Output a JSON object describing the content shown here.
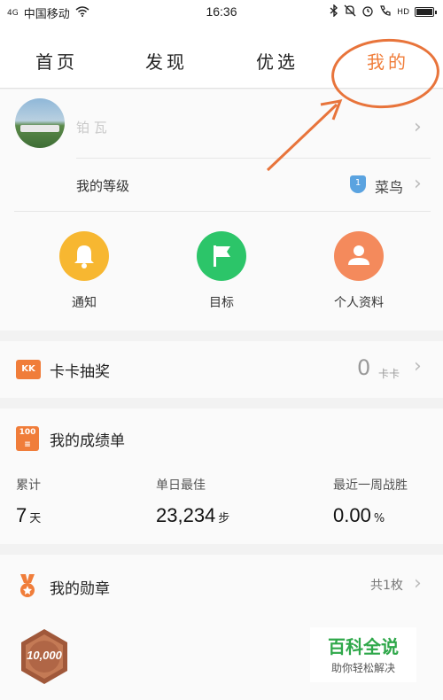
{
  "status_bar": {
    "signal": "4G",
    "carrier": "中国移动",
    "time": "16:36",
    "battery_label": "HD"
  },
  "top_tabs": [
    {
      "label": "首页",
      "active": false
    },
    {
      "label": "发现",
      "active": false
    },
    {
      "label": "优选",
      "active": false
    },
    {
      "label": "我的",
      "active": true
    }
  ],
  "profile": {
    "username": "铂 瓦",
    "level_label": "我的等级",
    "level_badge": "1",
    "level_value": "菜鸟"
  },
  "shortcuts": [
    {
      "label": "通知",
      "icon": "bell-icon",
      "color": "#f7b731"
    },
    {
      "label": "目标",
      "icon": "flag-icon",
      "color": "#2cc569"
    },
    {
      "label": "个人资料",
      "icon": "person-icon",
      "color": "#f48a5c"
    }
  ],
  "kaka": {
    "icon": "KK",
    "title": "卡卡抽奖",
    "count": "0",
    "unit": "卡卡"
  },
  "record": {
    "icon": "100",
    "title": "我的成绩单",
    "stats": [
      {
        "label": "累计",
        "value": "7",
        "unit": "天"
      },
      {
        "label": "单日最佳",
        "value": "23,234",
        "unit": "步"
      },
      {
        "label": "最近一周战胜",
        "value": "0.00",
        "unit": "%"
      }
    ]
  },
  "medal": {
    "title": "我的勋章",
    "count": "共1枚",
    "badge_text": "10,000"
  },
  "watermark": {
    "title": "百科全说",
    "subtitle": "助你轻松解决"
  },
  "colors": {
    "accent": "#f07d3a",
    "annotation": "#e8743b"
  }
}
